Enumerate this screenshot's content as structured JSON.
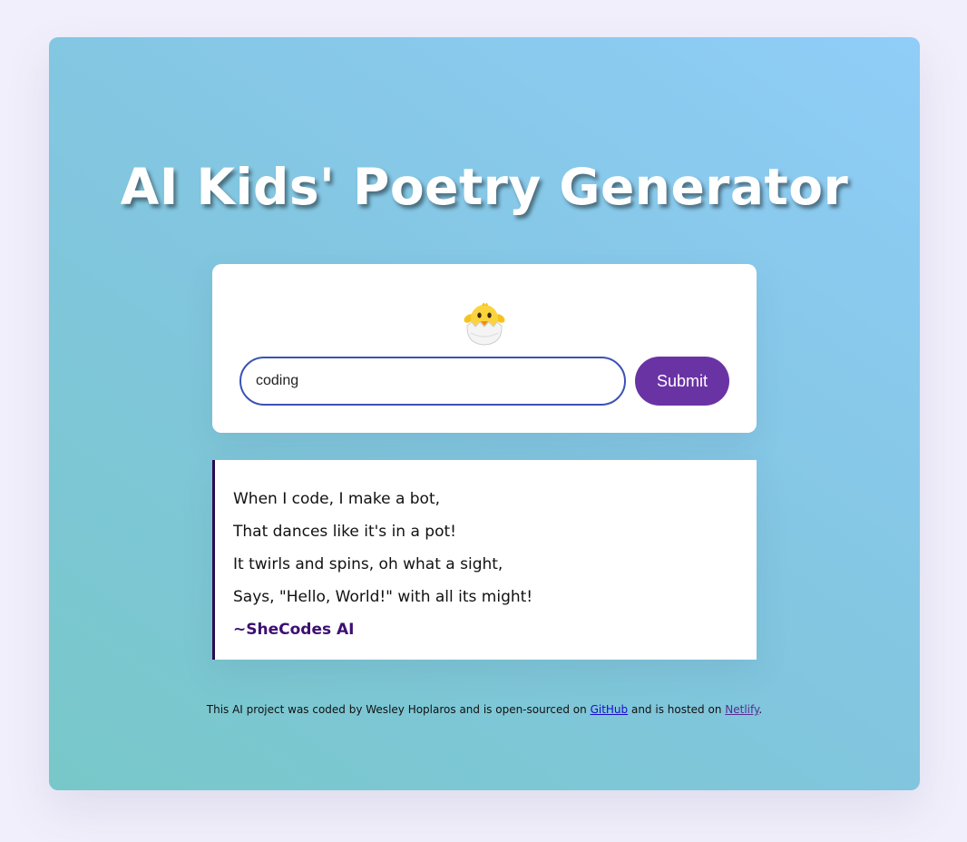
{
  "header": {
    "title": "AI Kids' Poetry Generator"
  },
  "form": {
    "icon": "hatching-chick-icon",
    "input_value": "coding",
    "submit_label": "Submit"
  },
  "poem": {
    "lines": [
      "When I code, I make a bot,",
      "That dances like it's in a pot!",
      "It twirls and spins, oh what a sight,",
      "Says, \"Hello, World!\" with all its might!"
    ],
    "signature": "~SheCodes AI"
  },
  "footer": {
    "text_before": "This AI project was coded by Wesley Hoplaros and is open-sourced on ",
    "github_label": "GitHub",
    "text_middle": " and is hosted on ",
    "netlify_label": "Netlify",
    "text_after": "."
  },
  "colors": {
    "submit_button": "#6a33a4",
    "input_border": "#3a52b5",
    "poem_border": "#2c0b52",
    "signature": "#3d0f72"
  }
}
